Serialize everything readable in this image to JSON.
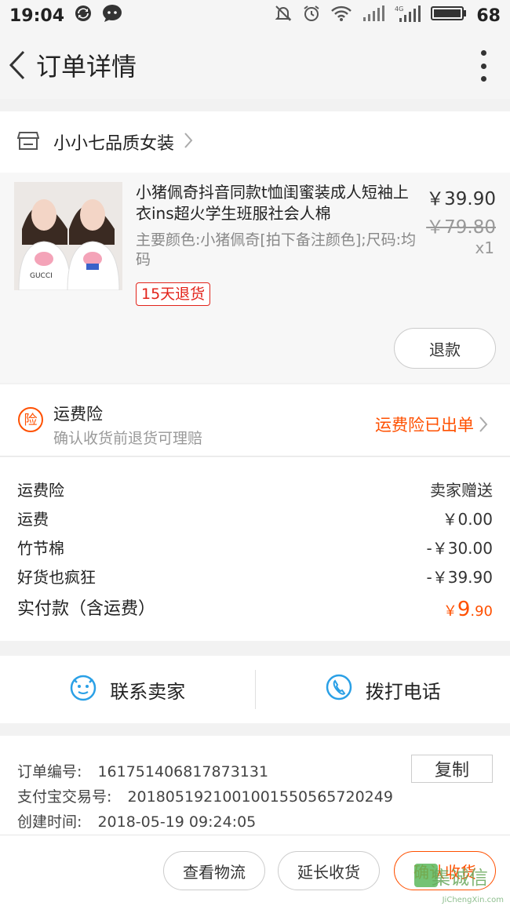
{
  "status_bar": {
    "time": "19:04",
    "battery": "68",
    "icons": [
      "sync-icon",
      "chat-bubble-icon",
      "mute-icon",
      "alarm-icon",
      "wifi-icon",
      "signal-icon",
      "signal-4g-icon",
      "battery-icon"
    ]
  },
  "nav": {
    "title": "订单详情"
  },
  "shop": {
    "name": "小小七品质女装"
  },
  "item": {
    "title": "小猪佩奇抖音同款t恤闺蜜装成人短袖上衣ins超火学生班服社会人棉",
    "spec": "主要颜色:小猪佩奇[拍下备注颜色];尺码:均码",
    "badge": "15天退货",
    "price": "￥39.90",
    "original_price": "￥79.80",
    "quantity": "x1",
    "refund_label": "退款"
  },
  "insurance": {
    "icon_char": "险",
    "title": "运费险",
    "subtitle": "确认收货前退货可理赔",
    "status": "运费险已出单"
  },
  "fees": {
    "rows": [
      {
        "label": "运费险",
        "value": "卖家赠送"
      },
      {
        "label": "运费",
        "value": "￥0.00"
      },
      {
        "label": "竹节棉",
        "value": "-￥30.00"
      },
      {
        "label": "好货也疯狂",
        "value": "-￥39.90"
      }
    ],
    "total_label": "实付款（含运费）",
    "total_currency": "￥",
    "total_int": "9",
    "total_dec": ".90"
  },
  "contact": {
    "seller_label": "联系卖家",
    "phone_label": "拨打电话"
  },
  "order_info": {
    "order_no_label": "订单编号:",
    "order_no": "161751406817873131",
    "copy_label": "复制",
    "alipay_label": "支付宝交易号:",
    "alipay_no": "2018051921001001550565720249",
    "created_label": "创建时间:",
    "created_time": "2018-05-19 09:24:05"
  },
  "actions": {
    "logistics": "查看物流",
    "extend": "延长收货",
    "confirm": "确认收货"
  },
  "watermark": {
    "text": "集诚信",
    "sub": "JiChengXin.com"
  },
  "colors": {
    "accent": "#ff5000",
    "badge_red": "#e2231a",
    "contact_blue": "#2aa0e6"
  }
}
